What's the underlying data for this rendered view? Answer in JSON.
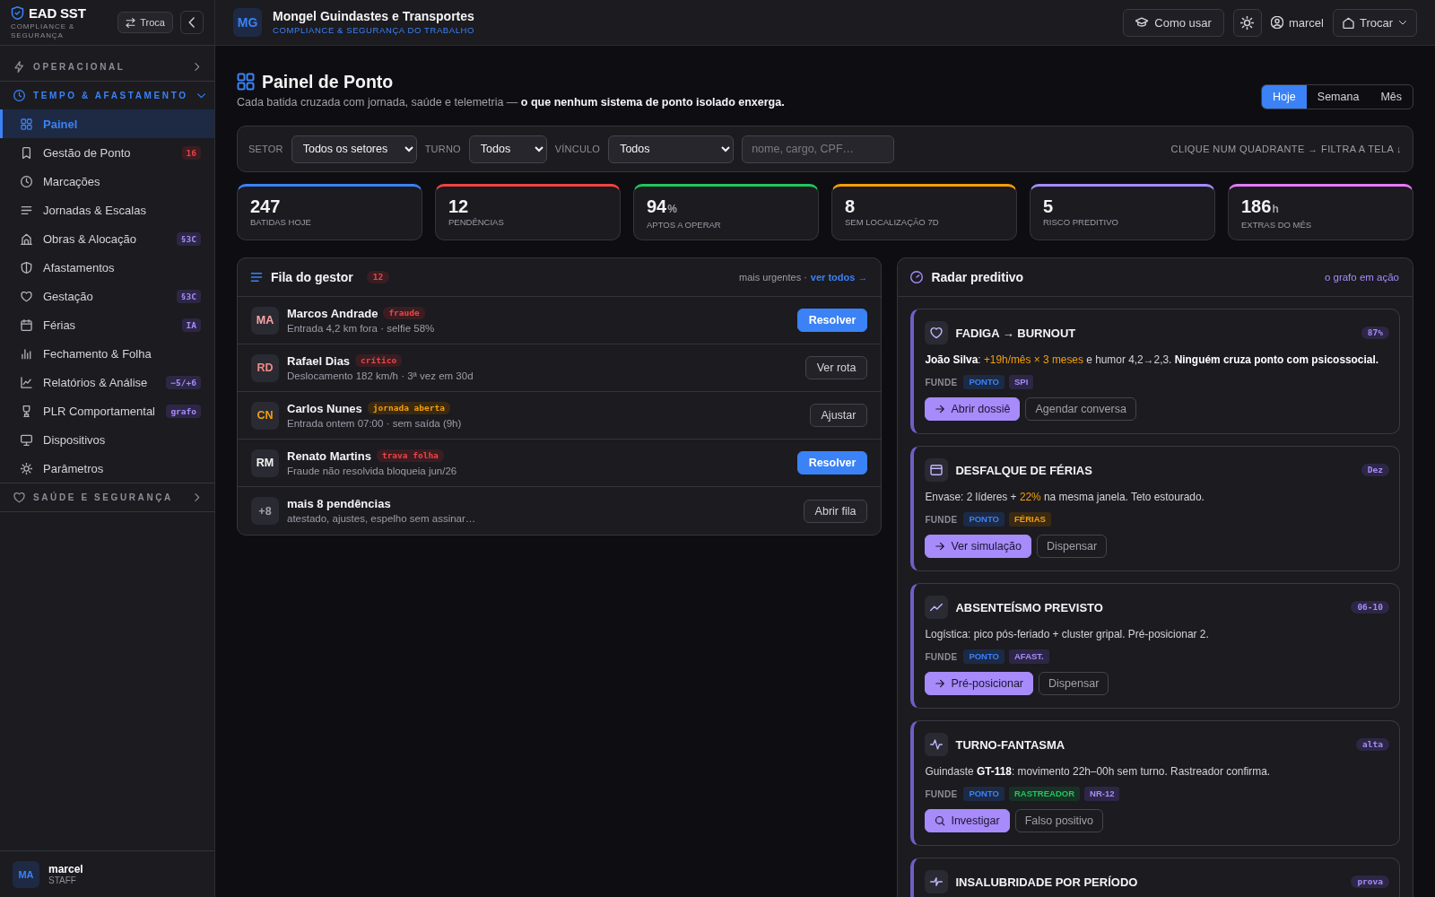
{
  "sidebar": {
    "brand": {
      "title": "EAD SST",
      "subtitle": "COMPLIANCE & SEGURANÇA",
      "switch_button": "Troca"
    },
    "sections": [
      {
        "label": "OPERACIONAL",
        "expanded": false
      },
      {
        "label": "TEMPO & AFASTAMENTO",
        "expanded": true,
        "items": [
          {
            "label": "Painel",
            "selected": true
          },
          {
            "label": "Gestão de Ponto",
            "selected": false,
            "badge": {
              "text": "16",
              "kind": "danger"
            }
          },
          {
            "label": "Marcações",
            "selected": false
          },
          {
            "label": "Jornadas & Escalas",
            "selected": false
          },
          {
            "label": "Obras & Alocação",
            "selected": false,
            "badge": {
              "text": "§3C",
              "kind": "accent"
            }
          },
          {
            "label": "Afastamentos",
            "selected": false
          },
          {
            "label": "Gestação",
            "selected": false,
            "badge": {
              "text": "§3C",
              "kind": "accent"
            }
          },
          {
            "label": "Férias",
            "selected": false,
            "badge": {
              "text": "IA",
              "kind": "accent"
            }
          },
          {
            "label": "Fechamento & Folha",
            "selected": false
          },
          {
            "label": "Relatórios & Análise",
            "selected": false,
            "badge": {
              "text": "−5/+6",
              "kind": "accent"
            }
          },
          {
            "label": "PLR Comportamental",
            "selected": false,
            "badge": {
              "text": "grafo",
              "kind": "accent"
            }
          },
          {
            "label": "Dispositivos",
            "selected": false
          },
          {
            "label": "Parâmetros",
            "selected": false
          }
        ]
      },
      {
        "label": "SAÚDE E SEGURANÇA",
        "expanded": false
      }
    ],
    "user": {
      "initials": "MA",
      "name": "marcel",
      "role": "STAFF"
    }
  },
  "header": {
    "initials": "MG",
    "company": "Mongel Guindastes e Transportes",
    "subtitle": "COMPLIANCE & SEGURANÇA DO TRABALHO",
    "help_button": "Como usar",
    "user": "marcel",
    "switch_button": "Trocar"
  },
  "page": {
    "title": "Painel de Ponto",
    "subtitle": "Cada batida cruzada com jornada, saúde e telemetria — **o que nenhum sistema de ponto isolado enxerga.**",
    "periods": [
      {
        "label": "Hoje",
        "selected": true
      },
      {
        "label": "Semana",
        "selected": false
      },
      {
        "label": "Mês",
        "selected": false
      }
    ]
  },
  "filters": {
    "fields": [
      {
        "label": "SETOR",
        "value": "Todos os setores"
      },
      {
        "label": "TURNO",
        "value": "Todos"
      },
      {
        "label": "VÍNCULO",
        "value": "Todos"
      }
    ],
    "search": {
      "placeholder": "nome, cargo, CPF…"
    },
    "hint": "CLIQUE NUM QUADRANTE → FILTRA A TELA ↓"
  },
  "stats": [
    {
      "value": "247",
      "label": "BATIDAS HOJE",
      "color": "#3b82f6"
    },
    {
      "value": "12",
      "label": "PENDÊNCIAS",
      "color": "#ef4444"
    },
    {
      "value": "94",
      "unit": "%",
      "label": "APTOS A OPERAR",
      "color": "#22c55e"
    },
    {
      "value": "8",
      "label": "SEM LOCALIZAÇÃO 7D",
      "color": "#f59e0b"
    },
    {
      "value": "5",
      "label": "RISCO PREDITIVO",
      "color": "#a78bfa"
    },
    {
      "value": "186",
      "unit": "h",
      "label": "EXTRAS DO MÊS",
      "color": "#e879f9"
    }
  ],
  "queue": {
    "title": "Fila do gestor",
    "count": "12",
    "meta": "mais urgentes ·",
    "link": "ver todos →",
    "rows": [
      {
        "initials": "MA",
        "color": "#fca5a5",
        "name": "Marcos Andrade",
        "tag": {
          "text": "fraude",
          "kind": "danger"
        },
        "detail": "Entrada 4,2 km fora · selfie 58%",
        "action": {
          "label": "Resolver",
          "kind": "primary"
        }
      },
      {
        "initials": "RD",
        "color": "#f08a80",
        "name": "Rafael Dias",
        "tag": {
          "text": "crítico",
          "kind": "danger"
        },
        "detail": "Deslocamento 182 km/h · 3ª vez em 30d",
        "action": {
          "label": "Ver rota",
          "kind": "secondary"
        }
      },
      {
        "initials": "CN",
        "color": "#f59e0b",
        "name": "Carlos Nunes",
        "tag": {
          "text": "jornada aberta",
          "kind": "warning"
        },
        "detail": "Entrada ontem 07:00 · sem saída (9h)",
        "action": {
          "label": "Ajustar",
          "kind": "secondary"
        }
      },
      {
        "initials": "RM",
        "color": "#f4f4f5",
        "name": "Renato Martins",
        "tag": {
          "text": "trava folha",
          "kind": "danger"
        },
        "detail": "Fraude não resolvida bloqueia jun/26",
        "action": {
          "label": "Resolver",
          "kind": "primary"
        }
      },
      {
        "initials": "+8",
        "color": "#a1a1aa",
        "name": "mais 8 pendências",
        "detail": "atestado, ajustes, espelho sem assinar…",
        "action": {
          "label": "Abrir fila",
          "kind": "secondary"
        }
      }
    ]
  },
  "radar": {
    "title": "Radar preditivo",
    "link": "o grafo em ação",
    "cards": [
      {
        "kind": "fatigue",
        "title": "FADIGA → BURNOUT",
        "badge": "87%",
        "description": [
          {
            "text": "João Silva",
            "kind": "emphasis"
          },
          {
            "text": ": ",
            "kind": "plain"
          },
          {
            "text": "+19h/mês × 3 meses",
            "kind": "metric"
          },
          {
            "text": " e humor 4,2→2,3. ",
            "kind": "plain"
          },
          {
            "text": "Ninguém cruza ponto com psicossocial.",
            "kind": "emphasis"
          }
        ],
        "source_label": "FUNDE",
        "sources": [
          {
            "text": "PONTO",
            "kind": "info"
          },
          {
            "text": "SPI",
            "kind": "accent"
          }
        ],
        "actions": [
          {
            "label": "Abrir dossiê",
            "kind": "open"
          },
          {
            "label": "Agendar conversa",
            "kind": "plain"
          }
        ]
      },
      {
        "kind": "vacation",
        "title": "DESFALQUE DE FÉRIAS",
        "badge": "Dez",
        "description": [
          {
            "text": "Envase: 2 líderes + ",
            "kind": "plain"
          },
          {
            "text": "22%",
            "kind": "metric"
          },
          {
            "text": " na mesma janela. Teto estourado.",
            "kind": "plain"
          }
        ],
        "source_label": "FUNDE",
        "sources": [
          {
            "text": "PONTO",
            "kind": "info"
          },
          {
            "text": "FÉRIAS",
            "kind": "warning"
          }
        ],
        "actions": [
          {
            "label": "Ver simulação",
            "kind": "open"
          },
          {
            "label": "Dispensar",
            "kind": "plain"
          }
        ]
      },
      {
        "kind": "absence",
        "title": "ABSENTEÍSMO PREVISTO",
        "badge": "06-10",
        "description": [
          {
            "text": "Logística: pico pós-feriado + cluster gripal. Pré-posicionar 2.",
            "kind": "plain"
          }
        ],
        "source_label": "FUNDE",
        "sources": [
          {
            "text": "PONTO",
            "kind": "info"
          },
          {
            "text": "AFAST.",
            "kind": "accent"
          }
        ],
        "actions": [
          {
            "label": "Pré-posicionar",
            "kind": "open"
          },
          {
            "label": "Dispensar",
            "kind": "plain"
          }
        ]
      },
      {
        "kind": "ghost",
        "title": "TURNO-FANTASMA",
        "badge": "alta",
        "description": [
          {
            "text": "Guindaste ",
            "kind": "plain"
          },
          {
            "text": "GT-118",
            "kind": "emphasis"
          },
          {
            "text": ": movimento 22h–00h sem turno. Rastreador confirma.",
            "kind": "plain"
          }
        ],
        "source_label": "FUNDE",
        "sources": [
          {
            "text": "PONTO",
            "kind": "info"
          },
          {
            "text": "RASTREADOR",
            "kind": "success"
          },
          {
            "text": "NR-12",
            "kind": "accent"
          }
        ],
        "actions": [
          {
            "label": "Investigar",
            "kind": "search"
          },
          {
            "label": "Falso positivo",
            "kind": "plain"
          }
        ]
      },
      {
        "kind": "exposure",
        "title": "INSALUBRIDADE POR PERÍODO",
        "badge": "prova"
      }
    ]
  }
}
